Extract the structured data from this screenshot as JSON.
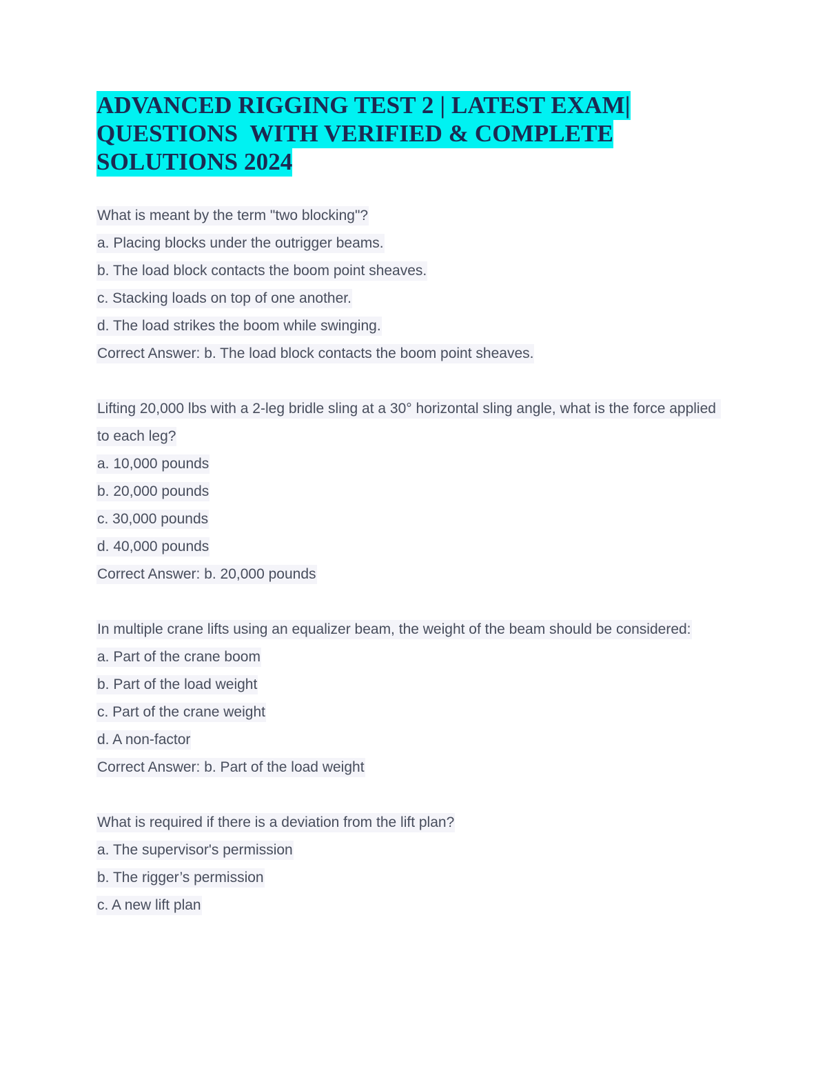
{
  "document": {
    "title_lines": [
      "ADVANCED RIGGING TEST 2 | LATEST EXAM|",
      "QUESTIONS  WITH VERIFIED & COMPLETE",
      "SOLUTIONS 2024"
    ],
    "title_highlight_color": "#00f2f2",
    "title_text_color": "#1c2a52",
    "body_highlight_color": "#f4f4f9",
    "body_text_color": "#474d5c",
    "page_background": "#ffffff"
  },
  "questions": [
    {
      "stem": "What is meant by the term \"two blocking\"?",
      "options": [
        "a. Placing blocks under the outrigger beams.",
        "b. The load block contacts the boom point sheaves.",
        "c. Stacking loads on top of one another.",
        "d. The load strikes the boom while swinging."
      ],
      "answer": "Correct Answer: b. The load block contacts the boom point sheaves."
    },
    {
      "stem": "Lifting 20,000 lbs with a 2-leg bridle sling at a 30° horizontal sling angle, what is the force applied to each leg?",
      "options": [
        "a. 10,000 pounds",
        "b. 20,000 pounds",
        "c. 30,000 pounds",
        "d. 40,000 pounds"
      ],
      "answer": "Correct Answer: b. 20,000 pounds"
    },
    {
      "stem": "In multiple crane lifts using an equalizer beam, the weight of the beam should be considered:",
      "options": [
        "a. Part of the crane boom",
        "b. Part of the load weight",
        "c. Part of the crane weight",
        "d. A non-factor"
      ],
      "answer": "Correct Answer: b. Part of the load weight"
    },
    {
      "stem": "What is required if there is a deviation from the lift plan?",
      "options": [
        "a. The supervisor's permission",
        "b. The rigger’s permission",
        "c. A new lift plan"
      ],
      "answer": null
    }
  ]
}
